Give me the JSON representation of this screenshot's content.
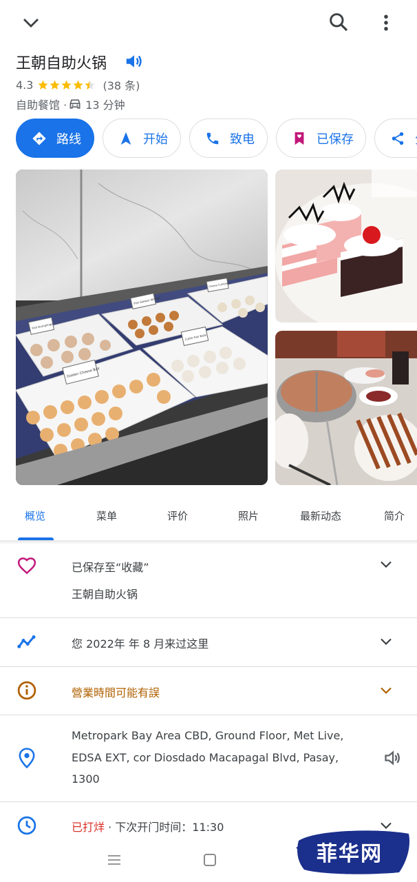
{
  "header": {
    "back_icon": "chevron-down-icon",
    "search_icon": "search-icon",
    "more_icon": "more-vert-icon"
  },
  "place": {
    "name": "王朝自助火锅",
    "rating": "4.3",
    "rating_value": 4.3,
    "review_count": "(38 条)",
    "category": "自助餐馆 ·",
    "drive_time": "13 分钟"
  },
  "actions": [
    {
      "label": "路线",
      "icon": "directions-icon"
    },
    {
      "label": "开始",
      "icon": "navigation-arrow-icon"
    },
    {
      "label": "致电",
      "icon": "phone-icon"
    },
    {
      "label": "已保存",
      "icon": "bookmark-icon"
    },
    {
      "label": "分",
      "icon": "share-icon"
    }
  ],
  "photo_labels": {
    "label1": "Fish Dumplings",
    "label2": "Fish Skewer Wheels",
    "label3": "Cheese Cuttlefish",
    "label4": "Golden Cheese Ball",
    "label5": "Cuttle Fish Balls"
  },
  "tabs": [
    "概览",
    "菜单",
    "评价",
    "照片",
    "最新动态",
    "简介"
  ],
  "active_tab": "概览",
  "saved": {
    "title": "已保存至“收藏”",
    "subtitle": "王朝自助火锅"
  },
  "visited": {
    "text": "您 2022年 年 8 月来过这里"
  },
  "hours_warning": {
    "text": "營業時間可能有誤"
  },
  "address": {
    "line1": "Metropark Bay Area CBD, Ground Floor, Met Live,",
    "line2": "EDSA EXT, cor Diosdado Macapagal Blvd, Pasay,",
    "line3": "1300"
  },
  "hours": {
    "status": "已打烊",
    "next": " · 下次开门时间：11:30"
  },
  "watermark": "菲华网",
  "colors": {
    "accent": "#1a73e8",
    "heart": "#c2187a",
    "warning": "#b06000",
    "closed": "#d93025"
  }
}
